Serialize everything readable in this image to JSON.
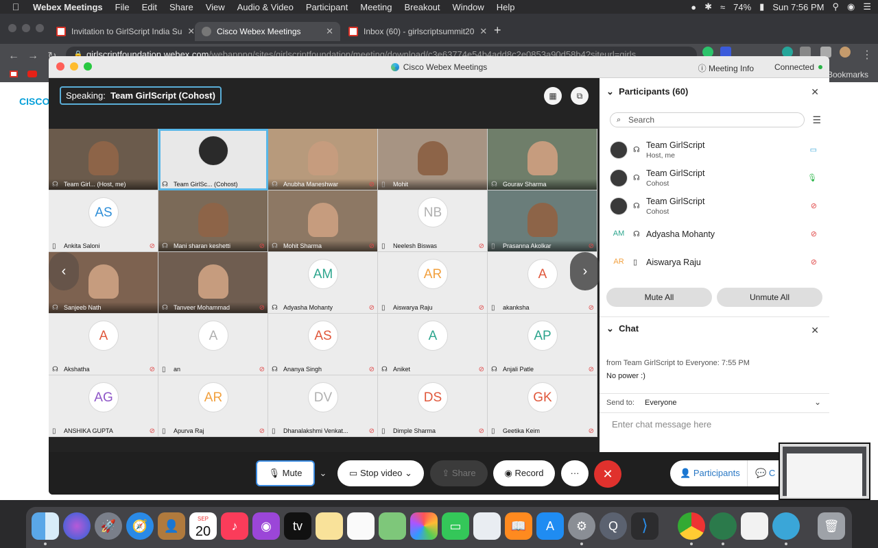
{
  "menubar": {
    "app": "Webex Meetings",
    "items": [
      "File",
      "Edit",
      "Share",
      "View",
      "Audio & Video",
      "Participant",
      "Meeting",
      "Breakout",
      "Window",
      "Help"
    ],
    "battery": "74%",
    "clock": "Sun 7:56 PM"
  },
  "browser": {
    "tabs": [
      {
        "title": "Invitation to GirlScript India Su"
      },
      {
        "title": "Cisco Webex Meetings"
      },
      {
        "title": "Inbox (60) - girlscriptsummit20"
      }
    ],
    "url_host": "girlscriptfoundation.webex.com",
    "url_path": "/webappng/sites/girlscriptfoundation/meeting/download/c3e63774e54b4add8c2e0853a90d58b4?siteurl=girls...",
    "bookmarks_label": "Bookmarks"
  },
  "page_behind": {
    "logo": "CISCO"
  },
  "webex": {
    "title": "Cisco Webex Meetings",
    "meeting_info": "Meeting Info",
    "connection": "Connected",
    "speaking_label": "Speaking:",
    "speaking_name": "Team GirlScript (Cohost)",
    "tiles": [
      {
        "name": "Team Girl...    (Host, me)",
        "type": "video",
        "device": "headset",
        "muted": false
      },
      {
        "name": "Team GirlSc...   (Cohost)",
        "type": "video-active",
        "device": "headset",
        "muted": false
      },
      {
        "name": "Anubha Maneshwar",
        "type": "video",
        "device": "headset",
        "muted": true
      },
      {
        "name": "Mohit",
        "type": "video",
        "device": "phone",
        "muted": false
      },
      {
        "name": "Gourav Sharma",
        "type": "video",
        "device": "headset",
        "muted": false
      },
      {
        "name": "Ankita Saloni",
        "type": "avatar",
        "initials": "AS",
        "color": "#2d8ed8",
        "device": "phone",
        "muted": true
      },
      {
        "name": "Mani sharan keshetti",
        "type": "video",
        "device": "headset",
        "muted": true
      },
      {
        "name": "Mohit Sharma",
        "type": "video",
        "device": "headset",
        "muted": true
      },
      {
        "name": "Neelesh Biswas",
        "type": "avatar",
        "initials": "NB",
        "color": "#b0b0b0",
        "device": "phone",
        "muted": true
      },
      {
        "name": "Prasanna Akolkar",
        "type": "video",
        "device": "phone",
        "muted": true
      },
      {
        "name": "Sanjeeb Nath",
        "type": "video",
        "device": "headset",
        "muted": false
      },
      {
        "name": "Tanveer Mohammad",
        "type": "video",
        "device": "headset",
        "muted": true
      },
      {
        "name": "Adyasha Mohanty",
        "type": "avatar",
        "initials": "AM",
        "color": "#2ca58d",
        "device": "headset",
        "muted": true
      },
      {
        "name": "Aiswarya Raju",
        "type": "avatar",
        "initials": "AR",
        "color": "#f2a03d",
        "device": "phone",
        "muted": true
      },
      {
        "name": "akanksha",
        "type": "avatar",
        "initials": "A",
        "color": "#e0573b",
        "device": "phone",
        "muted": true
      },
      {
        "name": "Akshatha",
        "type": "avatar",
        "initials": "A",
        "color": "#e0573b",
        "device": "headset",
        "muted": true
      },
      {
        "name": "an",
        "type": "avatar",
        "initials": "A",
        "color": "#b0b0b0",
        "device": "phone",
        "muted": true
      },
      {
        "name": "Ananya Singh",
        "type": "avatar",
        "initials": "AS",
        "color": "#e0573b",
        "device": "headset",
        "muted": true
      },
      {
        "name": "Aniket",
        "type": "avatar",
        "initials": "A",
        "color": "#2ca58d",
        "device": "headset",
        "muted": true
      },
      {
        "name": "Anjali Patle",
        "type": "avatar",
        "initials": "AP",
        "color": "#2ca58d",
        "device": "headset",
        "muted": true
      },
      {
        "name": "ANSHIKA GUPTA",
        "type": "avatar",
        "initials": "AG",
        "color": "#8e55c7",
        "device": "phone",
        "muted": true
      },
      {
        "name": "Apurva Raj",
        "type": "avatar",
        "initials": "AR",
        "color": "#f2a03d",
        "device": "phone",
        "muted": true
      },
      {
        "name": "Dhanalakshmi Venkat...",
        "type": "avatar",
        "initials": "DV",
        "color": "#b0b0b0",
        "device": "phone",
        "muted": true
      },
      {
        "name": "Dimple Sharma",
        "type": "avatar",
        "initials": "DS",
        "color": "#e0573b",
        "device": "phone",
        "muted": true
      },
      {
        "name": "Geetika Keim",
        "type": "avatar",
        "initials": "GK",
        "color": "#e0573b",
        "device": "phone",
        "muted": true
      }
    ],
    "participants_panel": {
      "title": "Participants (60)",
      "search_placeholder": "Search",
      "rows": [
        {
          "name": "Team GirlScript",
          "role": "Host, me",
          "avatar": "photo",
          "status": "video"
        },
        {
          "name": "Team GirlScript",
          "role": "Cohost",
          "avatar": "photo",
          "status": "mic-on"
        },
        {
          "name": "Team GirlScript",
          "role": "Cohost",
          "avatar": "photo",
          "status": "muted"
        },
        {
          "name": "Adyasha Mohanty",
          "role": "",
          "avatar": "AM",
          "color": "#2ca58d",
          "status": "muted"
        },
        {
          "name": "Aiswarya Raju",
          "role": "",
          "avatar": "AR",
          "color": "#f2a03d",
          "status": "muted"
        }
      ],
      "mute_all": "Mute All",
      "unmute_all": "Unmute All"
    },
    "chat_panel": {
      "title": "Chat",
      "from_line": "from Team GirlScript to Everyone:   7:55  PM",
      "message": "No power :)",
      "send_to_label": "Send to:",
      "send_to_value": "Everyone",
      "input_placeholder": "Enter chat message here"
    },
    "toolbar": {
      "mute": "Mute",
      "stop_video": "Stop video",
      "share": "Share",
      "record": "Record",
      "more": "···",
      "participants": "Participants",
      "chat_partial": "C"
    }
  },
  "dock": {
    "calendar_month": "SEP",
    "calendar_day": "20"
  }
}
